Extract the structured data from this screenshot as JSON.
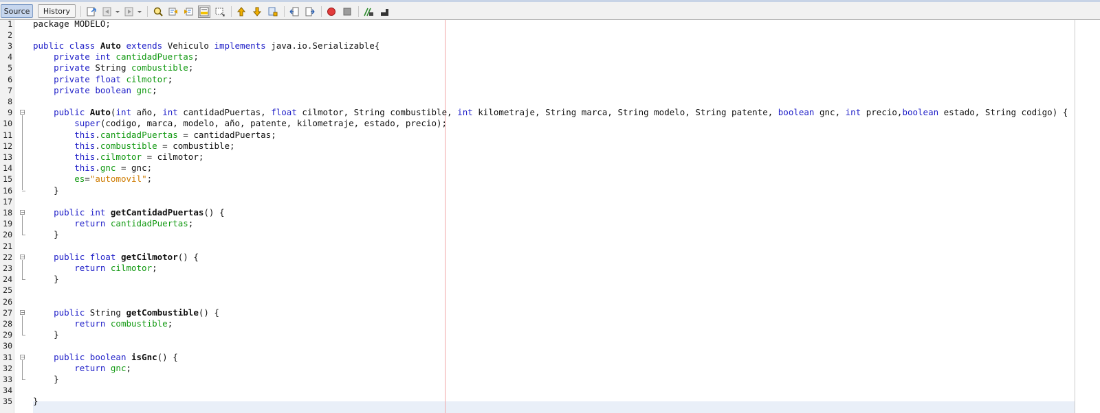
{
  "tabs": [
    {
      "label": "Source",
      "active": true
    },
    {
      "label": "History",
      "active": false
    }
  ],
  "toolbar_icons": [
    "last-edit-icon",
    "back-icon",
    "forward-icon",
    "find-icon",
    "find-previous-icon",
    "find-next-icon",
    "highlight-toggle-icon",
    "find-selection-icon",
    "previous-bookmark-icon",
    "next-bookmark-icon",
    "toggle-bookmark-icon",
    "shift-left-icon",
    "shift-right-icon",
    "start-macro-icon",
    "stop-macro-icon",
    "comment-icon",
    "uncomment-icon"
  ],
  "colors": {
    "keyword": "#2020c8",
    "field": "#119911",
    "string": "#ce7b00",
    "margin": "#f0a5a5"
  },
  "code": {
    "lines": [
      [
        {
          "t": "t",
          "v": "package MODELO;"
        }
      ],
      [],
      [
        {
          "t": "k",
          "v": "public class "
        },
        {
          "t": "b",
          "v": "Auto"
        },
        {
          "t": "k",
          "v": " extends "
        },
        {
          "t": "t",
          "v": "Vehiculo "
        },
        {
          "t": "k",
          "v": "implements "
        },
        {
          "t": "t",
          "v": "java.io.Serializable{"
        }
      ],
      [
        {
          "t": "t",
          "v": "    "
        },
        {
          "t": "k",
          "v": "private int "
        },
        {
          "t": "f",
          "v": "cantidadPuertas"
        },
        {
          "t": "t",
          "v": ";"
        }
      ],
      [
        {
          "t": "t",
          "v": "    "
        },
        {
          "t": "k",
          "v": "private "
        },
        {
          "t": "t",
          "v": "String "
        },
        {
          "t": "f",
          "v": "combustible"
        },
        {
          "t": "t",
          "v": ";"
        }
      ],
      [
        {
          "t": "t",
          "v": "    "
        },
        {
          "t": "k",
          "v": "private float "
        },
        {
          "t": "f",
          "v": "cilmotor"
        },
        {
          "t": "t",
          "v": ";"
        }
      ],
      [
        {
          "t": "t",
          "v": "    "
        },
        {
          "t": "k",
          "v": "private boolean "
        },
        {
          "t": "f",
          "v": "gnc"
        },
        {
          "t": "t",
          "v": ";"
        }
      ],
      [],
      [
        {
          "t": "t",
          "v": "    "
        },
        {
          "t": "k",
          "v": "public "
        },
        {
          "t": "b",
          "v": "Auto"
        },
        {
          "t": "t",
          "v": "("
        },
        {
          "t": "k",
          "v": "int "
        },
        {
          "t": "t",
          "v": "año, "
        },
        {
          "t": "k",
          "v": "int "
        },
        {
          "t": "t",
          "v": "cantidadPuertas, "
        },
        {
          "t": "k",
          "v": "float "
        },
        {
          "t": "t",
          "v": "cilmotor, String combustible, "
        },
        {
          "t": "k",
          "v": "int "
        },
        {
          "t": "t",
          "v": "kilometraje, String marca, String modelo, String patente, "
        },
        {
          "t": "k",
          "v": "boolean "
        },
        {
          "t": "t",
          "v": "gnc, "
        },
        {
          "t": "k",
          "v": "int "
        },
        {
          "t": "t",
          "v": "precio,"
        },
        {
          "t": "k",
          "v": "boolean "
        },
        {
          "t": "t",
          "v": "estado, String codigo) {"
        }
      ],
      [
        {
          "t": "t",
          "v": "        "
        },
        {
          "t": "k",
          "v": "super"
        },
        {
          "t": "t",
          "v": "(codigo, marca, modelo, año, patente, kilometraje, estado, precio);"
        }
      ],
      [
        {
          "t": "t",
          "v": "        "
        },
        {
          "t": "k",
          "v": "this"
        },
        {
          "t": "t",
          "v": "."
        },
        {
          "t": "f",
          "v": "cantidadPuertas"
        },
        {
          "t": "t",
          "v": " = cantidadPuertas;"
        }
      ],
      [
        {
          "t": "t",
          "v": "        "
        },
        {
          "t": "k",
          "v": "this"
        },
        {
          "t": "t",
          "v": "."
        },
        {
          "t": "f",
          "v": "combustible"
        },
        {
          "t": "t",
          "v": " = combustible;"
        }
      ],
      [
        {
          "t": "t",
          "v": "        "
        },
        {
          "t": "k",
          "v": "this"
        },
        {
          "t": "t",
          "v": "."
        },
        {
          "t": "f",
          "v": "cilmotor"
        },
        {
          "t": "t",
          "v": " = cilmotor;"
        }
      ],
      [
        {
          "t": "t",
          "v": "        "
        },
        {
          "t": "k",
          "v": "this"
        },
        {
          "t": "t",
          "v": "."
        },
        {
          "t": "f",
          "v": "gnc"
        },
        {
          "t": "t",
          "v": " = gnc;"
        }
      ],
      [
        {
          "t": "t",
          "v": "        "
        },
        {
          "t": "f",
          "v": "es"
        },
        {
          "t": "t",
          "v": "="
        },
        {
          "t": "s",
          "v": "\"automovil\""
        },
        {
          "t": "t",
          "v": ";"
        }
      ],
      [
        {
          "t": "t",
          "v": "    }"
        }
      ],
      [],
      [
        {
          "t": "t",
          "v": "    "
        },
        {
          "t": "k",
          "v": "public int "
        },
        {
          "t": "b",
          "v": "getCantidadPuertas"
        },
        {
          "t": "t",
          "v": "() {"
        }
      ],
      [
        {
          "t": "t",
          "v": "        "
        },
        {
          "t": "k",
          "v": "return "
        },
        {
          "t": "f",
          "v": "cantidadPuertas"
        },
        {
          "t": "t",
          "v": ";"
        }
      ],
      [
        {
          "t": "t",
          "v": "    }"
        }
      ],
      [],
      [
        {
          "t": "t",
          "v": "    "
        },
        {
          "t": "k",
          "v": "public float "
        },
        {
          "t": "b",
          "v": "getCilmotor"
        },
        {
          "t": "t",
          "v": "() {"
        }
      ],
      [
        {
          "t": "t",
          "v": "        "
        },
        {
          "t": "k",
          "v": "return "
        },
        {
          "t": "f",
          "v": "cilmotor"
        },
        {
          "t": "t",
          "v": ";"
        }
      ],
      [
        {
          "t": "t",
          "v": "    }"
        }
      ],
      [],
      [],
      [
        {
          "t": "t",
          "v": "    "
        },
        {
          "t": "k",
          "v": "public "
        },
        {
          "t": "t",
          "v": "String "
        },
        {
          "t": "b",
          "v": "getCombustible"
        },
        {
          "t": "t",
          "v": "() {"
        }
      ],
      [
        {
          "t": "t",
          "v": "        "
        },
        {
          "t": "k",
          "v": "return "
        },
        {
          "t": "f",
          "v": "combustible"
        },
        {
          "t": "t",
          "v": ";"
        }
      ],
      [
        {
          "t": "t",
          "v": "    }"
        }
      ],
      [],
      [
        {
          "t": "t",
          "v": "    "
        },
        {
          "t": "k",
          "v": "public boolean "
        },
        {
          "t": "b",
          "v": "isGnc"
        },
        {
          "t": "t",
          "v": "() {"
        }
      ],
      [
        {
          "t": "t",
          "v": "        "
        },
        {
          "t": "k",
          "v": "return "
        },
        {
          "t": "f",
          "v": "gnc"
        },
        {
          "t": "t",
          "v": ";"
        }
      ],
      [
        {
          "t": "t",
          "v": "    }"
        }
      ],
      [],
      [
        {
          "t": "t",
          "v": "}"
        }
      ]
    ],
    "folds": [
      [
        9,
        16
      ],
      [
        18,
        20
      ],
      [
        22,
        24
      ],
      [
        27,
        29
      ],
      [
        31,
        33
      ]
    ]
  }
}
